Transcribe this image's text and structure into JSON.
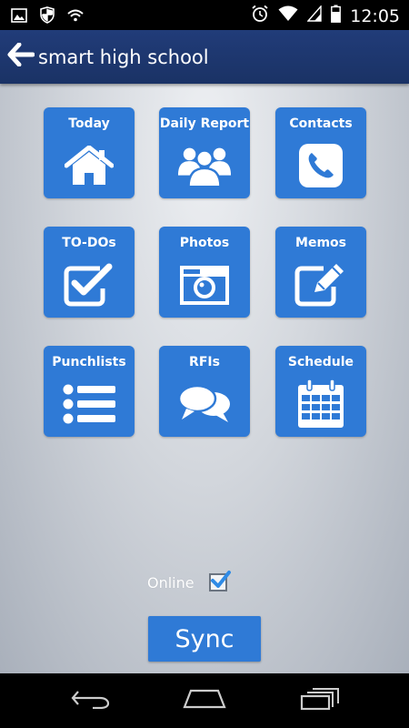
{
  "status_bar": {
    "time": "12:05",
    "icons": [
      "image-icon",
      "shield-icon",
      "sync-icon",
      "alarm-icon",
      "wifi-icon",
      "signal-icon",
      "battery-icon"
    ]
  },
  "app_bar": {
    "title": "smart high school",
    "back_icon": "arrow-left-icon"
  },
  "tiles": [
    {
      "label": "Today",
      "icon": "home-icon"
    },
    {
      "label": "Daily Report",
      "icon": "group-icon"
    },
    {
      "label": "Contacts",
      "icon": "phone-icon"
    },
    {
      "label": "TO-DOs",
      "icon": "checkbox-icon"
    },
    {
      "label": "Photos",
      "icon": "camera-icon"
    },
    {
      "label": "Memos",
      "icon": "edit-icon"
    },
    {
      "label": "Punchlists",
      "icon": "list-icon"
    },
    {
      "label": "RFIs",
      "icon": "chat-icon"
    },
    {
      "label": "Schedule",
      "icon": "calendar-icon"
    }
  ],
  "online": {
    "label": "Online",
    "checked": true
  },
  "sync_button": {
    "label": "Sync"
  },
  "colors": {
    "accent": "#2f7ad6",
    "app_bar": "#1f3a73",
    "check": "#2f8be6"
  },
  "nav_bar": {
    "icons": [
      "back-nav-icon",
      "home-nav-icon",
      "recents-nav-icon"
    ]
  }
}
